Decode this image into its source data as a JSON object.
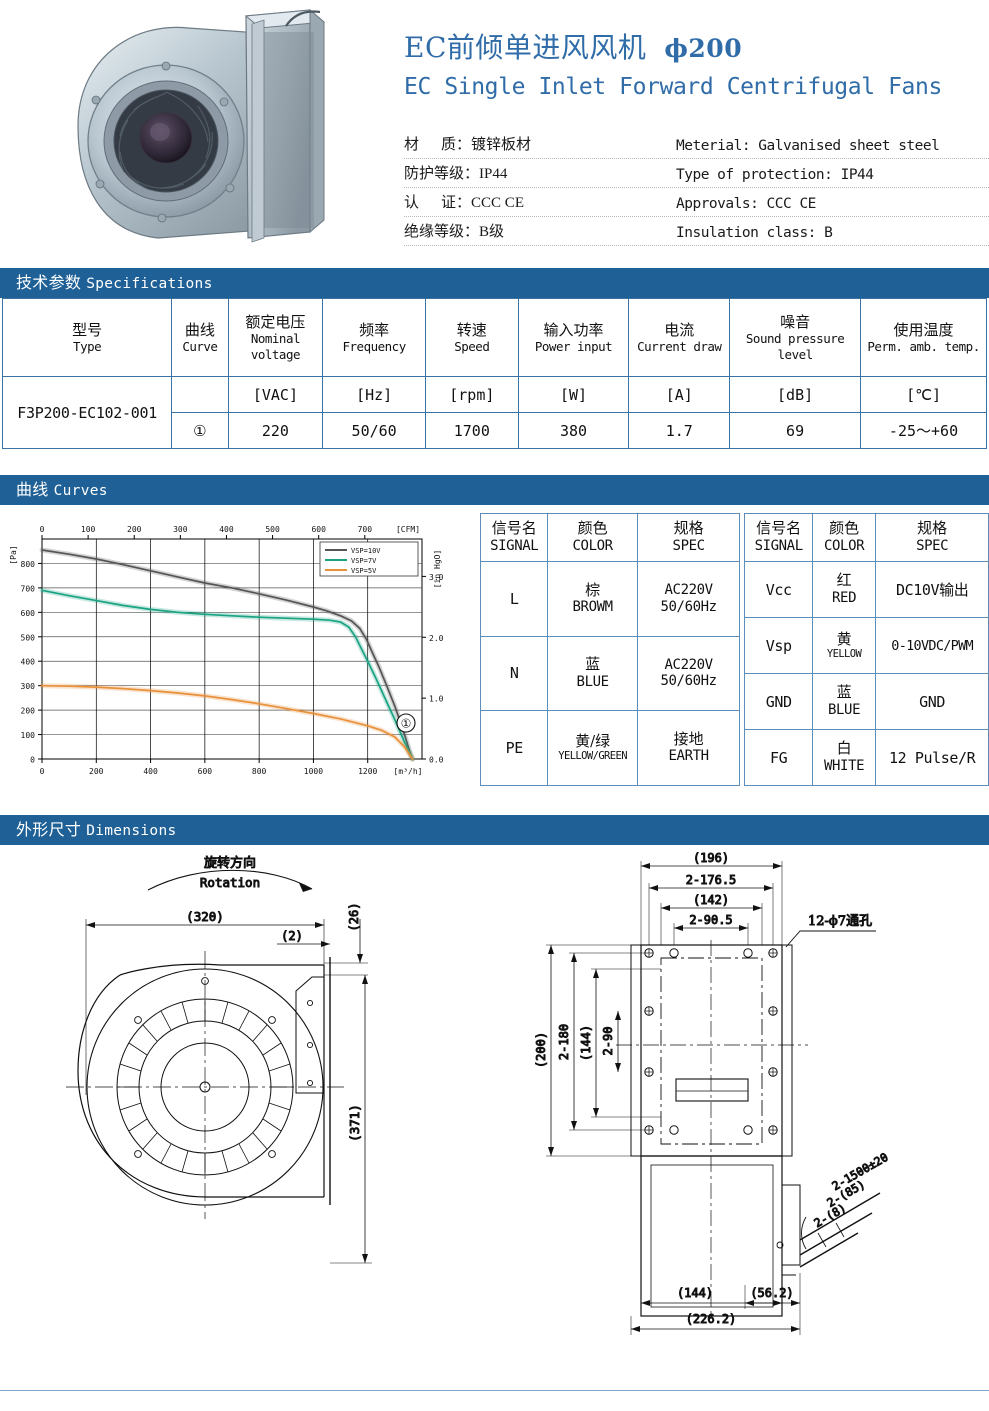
{
  "header": {
    "title_cn": "EC前倾单进风风机",
    "title_diameter": "ϕ200",
    "title_en": "EC Single Inlet Forward Centrifugal Fans",
    "photo_alt": "centrifugal-fan-photo",
    "properties": [
      {
        "cn_label": "材",
        "cn_label2": "质",
        "cn_value": "镀锌板材",
        "en": "Meterial: Galvanised sheet steel"
      },
      {
        "cn_label": "防护等级",
        "cn_label2": "",
        "cn_value": "IP44",
        "en": "Type of protection: IP44"
      },
      {
        "cn_label": "认",
        "cn_label2": "证",
        "cn_value": "CCC CE",
        "en": "Approvals: CCC CE"
      },
      {
        "cn_label": "绝缘等级",
        "cn_label2": "",
        "cn_value": "B级",
        "en": "Insulation class: B"
      }
    ]
  },
  "sections": {
    "specifications": {
      "cn": "技术参数",
      "en": "Specifications"
    },
    "curves": {
      "cn": "曲线",
      "en": "Curves"
    },
    "dimensions": {
      "cn": "外形尺寸",
      "en": "Dimensions"
    }
  },
  "spec_table": {
    "columns": [
      {
        "cn": "型号",
        "en": "Type"
      },
      {
        "cn": "曲线",
        "en": "Curve"
      },
      {
        "cn": "额定电压",
        "en": "Nominal voltage"
      },
      {
        "cn": "频率",
        "en": "Frequency"
      },
      {
        "cn": "转速",
        "en": "Speed"
      },
      {
        "cn": "输入功率",
        "en": "Power input"
      },
      {
        "cn": "电流",
        "en": "Current draw"
      },
      {
        "cn": "噪音",
        "en": "Sound pressure level"
      },
      {
        "cn": "使用温度",
        "en": "Perm. amb. temp."
      }
    ],
    "units_row": [
      "",
      "",
      "[VAC]",
      "[Hz]",
      "[rpm]",
      "[W]",
      "[A]",
      "[dB]",
      "[℃]"
    ],
    "value_row": [
      "F3P200-EC102-001",
      "①",
      "220",
      "50/60",
      "1700",
      "380",
      "1.7",
      "69",
      "-25～+60"
    ]
  },
  "chart_data": {
    "type": "line",
    "title": "",
    "xlabel": "[m³/h]",
    "ylabel": "[Pa]",
    "x_top_label": "[CFM]",
    "y_right_label": "[in HgO]",
    "xlim": [
      0,
      1400
    ],
    "ylim": [
      0,
      900
    ],
    "x_ticks": [
      0,
      200,
      400,
      600,
      800,
      1000,
      1200
    ],
    "x_top_ticks": [
      0,
      100,
      200,
      300,
      400,
      500,
      600,
      700
    ],
    "y_ticks": [
      0,
      100,
      200,
      300,
      400,
      500,
      600,
      700,
      800
    ],
    "y_right_ticks": [
      "0.0",
      "1.0",
      "2.0",
      "3.0"
    ],
    "grid": true,
    "legend_position": "top-right",
    "curve_marker": "①",
    "series": [
      {
        "name": "VSP=10V",
        "color": "#555555",
        "points": [
          [
            0,
            855
          ],
          [
            100,
            838
          ],
          [
            200,
            818
          ],
          [
            300,
            795
          ],
          [
            400,
            770
          ],
          [
            500,
            745
          ],
          [
            600,
            720
          ],
          [
            700,
            700
          ],
          [
            800,
            676
          ],
          [
            900,
            650
          ],
          [
            1000,
            622
          ],
          [
            1050,
            606
          ],
          [
            1100,
            586
          ],
          [
            1140,
            565
          ],
          [
            1170,
            535
          ],
          [
            1195,
            490
          ],
          [
            1215,
            440
          ],
          [
            1240,
            380
          ],
          [
            1270,
            300
          ],
          [
            1300,
            215
          ],
          [
            1330,
            120
          ],
          [
            1355,
            30
          ],
          [
            1365,
            0
          ]
        ]
      },
      {
        "name": "VSP=7V",
        "color": "#1aa383",
        "points": [
          [
            0,
            690
          ],
          [
            100,
            668
          ],
          [
            200,
            648
          ],
          [
            300,
            628
          ],
          [
            400,
            612
          ],
          [
            500,
            600
          ],
          [
            600,
            592
          ],
          [
            700,
            586
          ],
          [
            800,
            580
          ],
          [
            900,
            576
          ],
          [
            1000,
            572
          ],
          [
            1060,
            568
          ],
          [
            1100,
            560
          ],
          [
            1130,
            540
          ],
          [
            1155,
            500
          ],
          [
            1175,
            455
          ],
          [
            1200,
            400
          ],
          [
            1230,
            330
          ],
          [
            1265,
            245
          ],
          [
            1300,
            160
          ],
          [
            1335,
            70
          ],
          [
            1365,
            0
          ]
        ]
      },
      {
        "name": "VSP=5V",
        "color": "#e8913a",
        "points": [
          [
            0,
            300
          ],
          [
            100,
            298
          ],
          [
            200,
            294
          ],
          [
            300,
            288
          ],
          [
            400,
            280
          ],
          [
            500,
            270
          ],
          [
            600,
            258
          ],
          [
            700,
            243
          ],
          [
            800,
            226
          ],
          [
            900,
            206
          ],
          [
            1000,
            186
          ],
          [
            1100,
            164
          ],
          [
            1200,
            136
          ],
          [
            1250,
            118
          ],
          [
            1300,
            90
          ],
          [
            1335,
            50
          ],
          [
            1365,
            0
          ]
        ]
      }
    ]
  },
  "signal_tables": [
    {
      "id": "power-signal-table",
      "headers": [
        {
          "cn": "信号名",
          "en": "SIGNAL"
        },
        {
          "cn": "颜色",
          "en": "COLOR"
        },
        {
          "cn": "规格",
          "en": "SPEC"
        }
      ],
      "rows": [
        {
          "signal": "L",
          "color_cn": "棕",
          "color_en": "BROWM",
          "spec_l1": "AC220V",
          "spec_l2": "50/60Hz"
        },
        {
          "signal": "N",
          "color_cn": "蓝",
          "color_en": "BLUE",
          "spec_l1": "AC220V",
          "spec_l2": "50/60Hz"
        },
        {
          "signal": "PE",
          "color_cn": "黄/绿",
          "color_en": "YELLOW/GREEN",
          "spec_l1": "接地",
          "spec_l2": "EARTH"
        }
      ]
    },
    {
      "id": "control-signal-table",
      "headers": [
        {
          "cn": "信号名",
          "en": "SIGNAL"
        },
        {
          "cn": "颜色",
          "en": "COLOR"
        },
        {
          "cn": "规格",
          "en": "SPEC"
        }
      ],
      "rows": [
        {
          "signal": "Vcc",
          "color_cn": "红",
          "color_en": "RED",
          "spec_l1": "DC10V输出",
          "spec_l2": ""
        },
        {
          "signal": "Vsp",
          "color_cn": "黄",
          "color_en": "YELLOW",
          "spec_l1": "0-10VDC/PWM",
          "spec_l2": ""
        },
        {
          "signal": "GND",
          "color_cn": "蓝",
          "color_en": "BLUE",
          "spec_l1": "GND",
          "spec_l2": ""
        },
        {
          "signal": "FG",
          "color_cn": "白",
          "color_en": "WHITE",
          "spec_l1": "12 Pulse/R",
          "spec_l2": ""
        }
      ]
    }
  ],
  "dimensions_drawing": {
    "rotation_cn": "旋转方向",
    "rotation_en": "Rotation",
    "left_view": {
      "width_320": "(320)",
      "thickness_2": "(2)",
      "offset_26": "(26)",
      "height_371": "(371)"
    },
    "right_view": {
      "width_196": "(196)",
      "span_176_5": "2-176.5",
      "width_142": "(142)",
      "span_90_5": "2-90.5",
      "holes_note": "12-ϕ7通孔",
      "height_200": "(200)",
      "span_180": "2-180",
      "height_144": "(144)",
      "span_90": "2-90",
      "bottom_144": "(144)",
      "bottom_56_2": "(56.2)",
      "bottom_226_2": "(226.2)",
      "cable_len": "2-1500±20",
      "cable_85": "2-(85)",
      "cable_8": "2-(8)"
    }
  },
  "colors": {
    "brand_blue": "#1f6096",
    "title_blue": "#2f6ca8",
    "table_border": "#3a72a3",
    "curve_10v": "#555555",
    "curve_7v": "#1aa383",
    "curve_5v": "#e8913a"
  }
}
